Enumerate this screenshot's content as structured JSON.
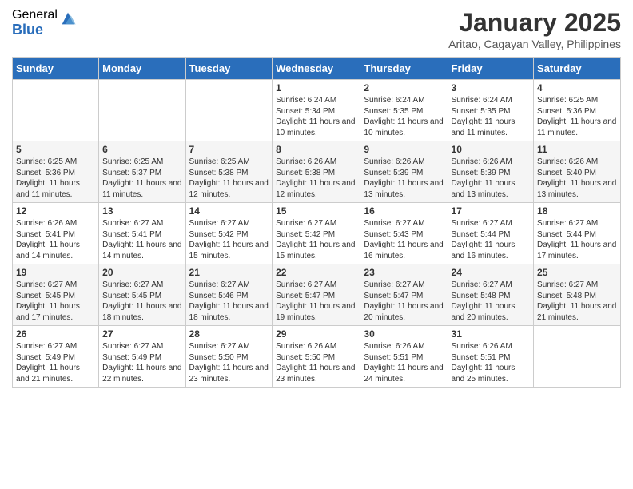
{
  "header": {
    "logo_general": "General",
    "logo_blue": "Blue",
    "month_title": "January 2025",
    "location": "Aritao, Cagayan Valley, Philippines"
  },
  "weekdays": [
    "Sunday",
    "Monday",
    "Tuesday",
    "Wednesday",
    "Thursday",
    "Friday",
    "Saturday"
  ],
  "weeks": [
    [
      {
        "day": "",
        "info": ""
      },
      {
        "day": "",
        "info": ""
      },
      {
        "day": "",
        "info": ""
      },
      {
        "day": "1",
        "info": "Sunrise: 6:24 AM\nSunset: 5:34 PM\nDaylight: 11 hours and 10 minutes."
      },
      {
        "day": "2",
        "info": "Sunrise: 6:24 AM\nSunset: 5:35 PM\nDaylight: 11 hours and 10 minutes."
      },
      {
        "day": "3",
        "info": "Sunrise: 6:24 AM\nSunset: 5:35 PM\nDaylight: 11 hours and 11 minutes."
      },
      {
        "day": "4",
        "info": "Sunrise: 6:25 AM\nSunset: 5:36 PM\nDaylight: 11 hours and 11 minutes."
      }
    ],
    [
      {
        "day": "5",
        "info": "Sunrise: 6:25 AM\nSunset: 5:36 PM\nDaylight: 11 hours and 11 minutes."
      },
      {
        "day": "6",
        "info": "Sunrise: 6:25 AM\nSunset: 5:37 PM\nDaylight: 11 hours and 11 minutes."
      },
      {
        "day": "7",
        "info": "Sunrise: 6:25 AM\nSunset: 5:38 PM\nDaylight: 11 hours and 12 minutes."
      },
      {
        "day": "8",
        "info": "Sunrise: 6:26 AM\nSunset: 5:38 PM\nDaylight: 11 hours and 12 minutes."
      },
      {
        "day": "9",
        "info": "Sunrise: 6:26 AM\nSunset: 5:39 PM\nDaylight: 11 hours and 13 minutes."
      },
      {
        "day": "10",
        "info": "Sunrise: 6:26 AM\nSunset: 5:39 PM\nDaylight: 11 hours and 13 minutes."
      },
      {
        "day": "11",
        "info": "Sunrise: 6:26 AM\nSunset: 5:40 PM\nDaylight: 11 hours and 13 minutes."
      }
    ],
    [
      {
        "day": "12",
        "info": "Sunrise: 6:26 AM\nSunset: 5:41 PM\nDaylight: 11 hours and 14 minutes."
      },
      {
        "day": "13",
        "info": "Sunrise: 6:27 AM\nSunset: 5:41 PM\nDaylight: 11 hours and 14 minutes."
      },
      {
        "day": "14",
        "info": "Sunrise: 6:27 AM\nSunset: 5:42 PM\nDaylight: 11 hours and 15 minutes."
      },
      {
        "day": "15",
        "info": "Sunrise: 6:27 AM\nSunset: 5:42 PM\nDaylight: 11 hours and 15 minutes."
      },
      {
        "day": "16",
        "info": "Sunrise: 6:27 AM\nSunset: 5:43 PM\nDaylight: 11 hours and 16 minutes."
      },
      {
        "day": "17",
        "info": "Sunrise: 6:27 AM\nSunset: 5:44 PM\nDaylight: 11 hours and 16 minutes."
      },
      {
        "day": "18",
        "info": "Sunrise: 6:27 AM\nSunset: 5:44 PM\nDaylight: 11 hours and 17 minutes."
      }
    ],
    [
      {
        "day": "19",
        "info": "Sunrise: 6:27 AM\nSunset: 5:45 PM\nDaylight: 11 hours and 17 minutes."
      },
      {
        "day": "20",
        "info": "Sunrise: 6:27 AM\nSunset: 5:45 PM\nDaylight: 11 hours and 18 minutes."
      },
      {
        "day": "21",
        "info": "Sunrise: 6:27 AM\nSunset: 5:46 PM\nDaylight: 11 hours and 18 minutes."
      },
      {
        "day": "22",
        "info": "Sunrise: 6:27 AM\nSunset: 5:47 PM\nDaylight: 11 hours and 19 minutes."
      },
      {
        "day": "23",
        "info": "Sunrise: 6:27 AM\nSunset: 5:47 PM\nDaylight: 11 hours and 20 minutes."
      },
      {
        "day": "24",
        "info": "Sunrise: 6:27 AM\nSunset: 5:48 PM\nDaylight: 11 hours and 20 minutes."
      },
      {
        "day": "25",
        "info": "Sunrise: 6:27 AM\nSunset: 5:48 PM\nDaylight: 11 hours and 21 minutes."
      }
    ],
    [
      {
        "day": "26",
        "info": "Sunrise: 6:27 AM\nSunset: 5:49 PM\nDaylight: 11 hours and 21 minutes."
      },
      {
        "day": "27",
        "info": "Sunrise: 6:27 AM\nSunset: 5:49 PM\nDaylight: 11 hours and 22 minutes."
      },
      {
        "day": "28",
        "info": "Sunrise: 6:27 AM\nSunset: 5:50 PM\nDaylight: 11 hours and 23 minutes."
      },
      {
        "day": "29",
        "info": "Sunrise: 6:26 AM\nSunset: 5:50 PM\nDaylight: 11 hours and 23 minutes."
      },
      {
        "day": "30",
        "info": "Sunrise: 6:26 AM\nSunset: 5:51 PM\nDaylight: 11 hours and 24 minutes."
      },
      {
        "day": "31",
        "info": "Sunrise: 6:26 AM\nSunset: 5:51 PM\nDaylight: 11 hours and 25 minutes."
      },
      {
        "day": "",
        "info": ""
      }
    ]
  ]
}
